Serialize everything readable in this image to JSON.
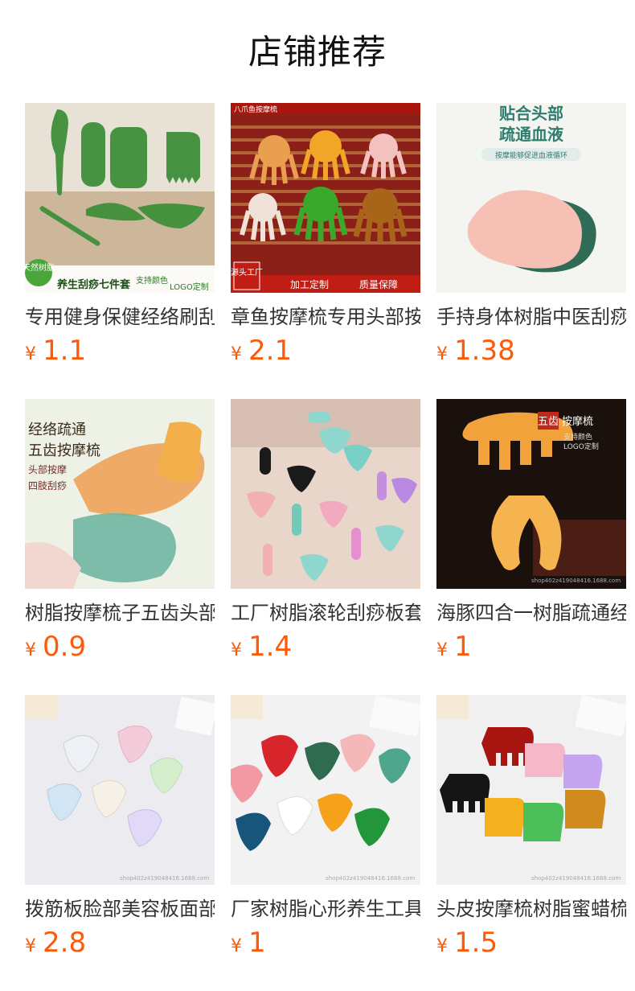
{
  "page": {
    "title": "店铺推荐"
  },
  "products": [
    {
      "name": "专用健身保健经络刷刮痧板",
      "currency": "¥",
      "price": "1.1",
      "overlay": {
        "badge": "天然树脂",
        "caption": "养生刮痧七件套",
        "tag": "支持颜色",
        "tag2": "LOGO定制"
      },
      "colors": {
        "bg": "#d9cbb8",
        "item": "#3f8f3a"
      }
    },
    {
      "name": "章鱼按摩梳专用头部按摩器",
      "currency": "¥",
      "price": "2.1",
      "overlay": {
        "top": "八爪鱼按摩梳",
        "badge": "源头工厂",
        "b1": "加工定制",
        "b2": "质量保障"
      },
      "colors": {
        "bg": "#7a1a10",
        "item": "#e07a20"
      }
    },
    {
      "name": "手持身体树脂中医刮痧板",
      "currency": "¥",
      "price": "1.38",
      "overlay": {
        "h1": "贴合头部",
        "h2": "疏通血液",
        "sub": "按摩能够促进血液循环"
      },
      "colors": {
        "bg": "#f3f4f0",
        "item": "#f5b7a8"
      }
    },
    {
      "name": "树脂按摩梳子五齿头部按摩",
      "currency": "¥",
      "price": "0.9",
      "overlay": {
        "l1": "经络疏通",
        "l2": "五齿按摩梳",
        "l3": "头部按摩",
        "l4": "四肢刮痧"
      },
      "colors": {
        "bg": "#e9efe2",
        "item": "#e88a3a"
      }
    },
    {
      "name": "工厂树脂滚轮刮痧板套装",
      "currency": "¥",
      "price": "1.4",
      "overlay": {},
      "colors": {
        "bg": "#e7d2c8",
        "item": "#8fd6cf"
      }
    },
    {
      "name": "海豚四合一树脂疏通经络梳",
      "currency": "¥",
      "price": "1",
      "overlay": {
        "t1": "五齿",
        "t2": "按摩梳",
        "sub1": "支持颜色",
        "sub2": "LOGO定制",
        "wm": "shop402z419048416.1688.com"
      },
      "colors": {
        "bg": "#1a0f0c",
        "item": "#f2a23a"
      }
    },
    {
      "name": "拨筋板脸部美容板面部刮痧",
      "currency": "¥",
      "price": "2.8",
      "overlay": {
        "wm": "shop402z419048416.1688.com"
      },
      "colors": {
        "bg": "#ececf0",
        "item": "#cfe6f5"
      }
    },
    {
      "name": "厂家树脂心形养生工具刮痧板",
      "currency": "¥",
      "price": "1",
      "overlay": {
        "wm": "shop402z419048416.1688.com"
      },
      "colors": {
        "bg": "#f1f1f1",
        "item": "#e94b4b"
      }
    },
    {
      "name": "头皮按摩梳树脂蜜蜡梳子",
      "currency": "¥",
      "price": "1.5",
      "overlay": {
        "wm": "shop402z419048416.1688.com"
      },
      "colors": {
        "bg": "#f0f0f0",
        "item": "#f5a623"
      }
    }
  ]
}
